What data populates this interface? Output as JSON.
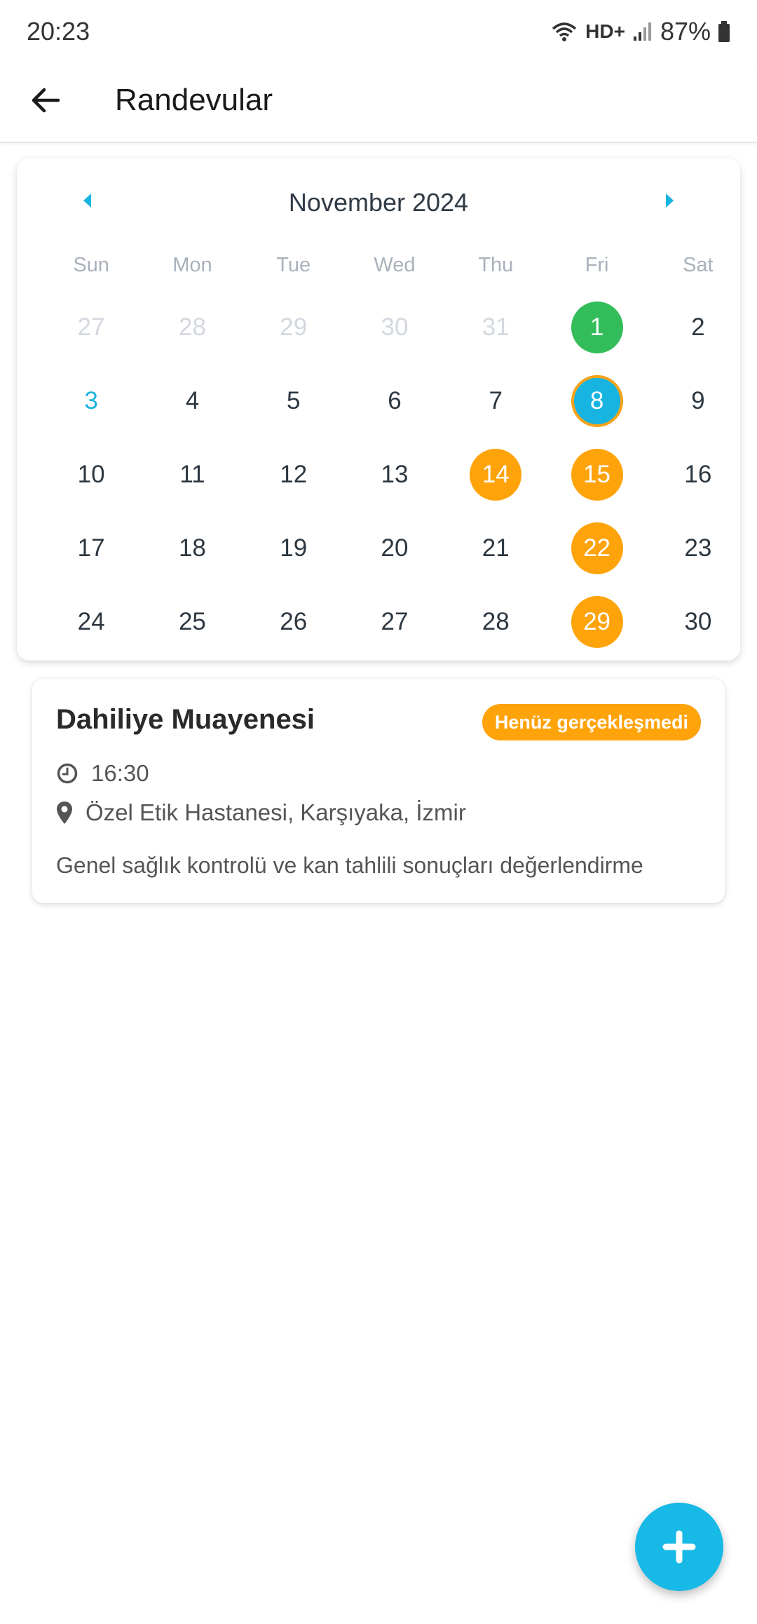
{
  "status_bar": {
    "time": "20:23",
    "network_label": "HD+",
    "battery": "87%"
  },
  "app_bar": {
    "title": "Randevular",
    "back_icon": "arrow-left-icon"
  },
  "calendar": {
    "month_label": "November 2024",
    "prev_icon": "caret-left-icon",
    "next_icon": "caret-right-icon",
    "weekdays": [
      "Sun",
      "Mon",
      "Tue",
      "Wed",
      "Thu",
      "Fri",
      "Sat"
    ],
    "weeks": [
      [
        {
          "label": "27",
          "state": "muted"
        },
        {
          "label": "28",
          "state": "muted"
        },
        {
          "label": "29",
          "state": "muted"
        },
        {
          "label": "30",
          "state": "muted"
        },
        {
          "label": "31",
          "state": "muted"
        },
        {
          "label": "1",
          "state": "green"
        },
        {
          "label": "2",
          "state": "normal"
        }
      ],
      [
        {
          "label": "3",
          "state": "today"
        },
        {
          "label": "4",
          "state": "normal"
        },
        {
          "label": "5",
          "state": "normal"
        },
        {
          "label": "6",
          "state": "normal"
        },
        {
          "label": "7",
          "state": "normal"
        },
        {
          "label": "8",
          "state": "selected"
        },
        {
          "label": "9",
          "state": "normal"
        }
      ],
      [
        {
          "label": "10",
          "state": "normal"
        },
        {
          "label": "11",
          "state": "normal"
        },
        {
          "label": "12",
          "state": "normal"
        },
        {
          "label": "13",
          "state": "normal"
        },
        {
          "label": "14",
          "state": "orange"
        },
        {
          "label": "15",
          "state": "orange"
        },
        {
          "label": "16",
          "state": "normal"
        }
      ],
      [
        {
          "label": "17",
          "state": "normal"
        },
        {
          "label": "18",
          "state": "normal"
        },
        {
          "label": "19",
          "state": "normal"
        },
        {
          "label": "20",
          "state": "normal"
        },
        {
          "label": "21",
          "state": "normal"
        },
        {
          "label": "22",
          "state": "orange"
        },
        {
          "label": "23",
          "state": "normal"
        }
      ],
      [
        {
          "label": "24",
          "state": "normal"
        },
        {
          "label": "25",
          "state": "normal"
        },
        {
          "label": "26",
          "state": "normal"
        },
        {
          "label": "27",
          "state": "normal"
        },
        {
          "label": "28",
          "state": "normal"
        },
        {
          "label": "29",
          "state": "orange"
        },
        {
          "label": "30",
          "state": "normal"
        }
      ]
    ],
    "colors": {
      "accent": "#17b4e2",
      "completed": "#33bd5a",
      "pending": "#ffa30b"
    }
  },
  "appointment": {
    "title": "Dahiliye Muayenesi",
    "status": "Henüz gerçekleşmedi",
    "time": "16:30",
    "time_icon": "clock-icon",
    "location": "Özel Etik Hastanesi, Karşıyaka, İzmir",
    "location_icon": "map-pin-icon",
    "description": "Genel sağlık kontrolü ve kan tahlili sonuçları değerlendirme"
  },
  "fab": {
    "icon": "plus-icon"
  }
}
